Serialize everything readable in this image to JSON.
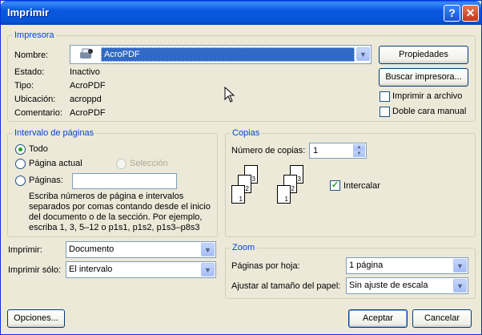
{
  "window": {
    "title": "Imprimir",
    "help_glyph": "?",
    "close_glyph": "✕"
  },
  "printer": {
    "group_label": "Impresora",
    "name_label": "Nombre:",
    "name_value": "AcroPDF",
    "status_label": "Estado:",
    "status_value": "Inactivo",
    "type_label": "Tipo:",
    "type_value": "AcroPDF",
    "location_label": "Ubicación:",
    "location_value": "acroppd",
    "comment_label": "Comentario:",
    "comment_value": "AcroPDF",
    "properties_button": "Propiedades",
    "find_button": "Buscar impresora...",
    "print_to_file": "Imprimir a archivo",
    "manual_duplex": "Doble cara manual"
  },
  "range": {
    "group_label": "Intervalo de páginas",
    "all": "Todo",
    "current": "Página actual",
    "selection": "Selección",
    "pages": "Páginas:",
    "pages_value": "",
    "help_lines": [
      "Escriba números de página e intervalos",
      "separados por comas contando desde el inicio",
      "del documento o de la sección. Por ejemplo,",
      "escriba 1, 3, 5–12 o p1s1, p1s2, p1s3–p8s3"
    ]
  },
  "copies": {
    "group_label": "Copias",
    "count_label": "Número de copias:",
    "count_value": "1",
    "collate": "Intercalar",
    "page_numbers": [
      "1",
      "2",
      "3"
    ]
  },
  "print_what": {
    "label": "Imprimir:",
    "value": "Documento"
  },
  "print_only": {
    "label": "Imprimir sólo:",
    "value": "El intervalo"
  },
  "zoom": {
    "group_label": "Zoom",
    "per_sheet_label": "Páginas por hoja:",
    "per_sheet_value": "1 página",
    "scale_label": "Ajustar al tamaño del papel:",
    "scale_value": "Sin ajuste de escala"
  },
  "buttons": {
    "options": "Opciones...",
    "ok": "Aceptar",
    "cancel": "Cancelar"
  },
  "arrow_glyph": "▼"
}
